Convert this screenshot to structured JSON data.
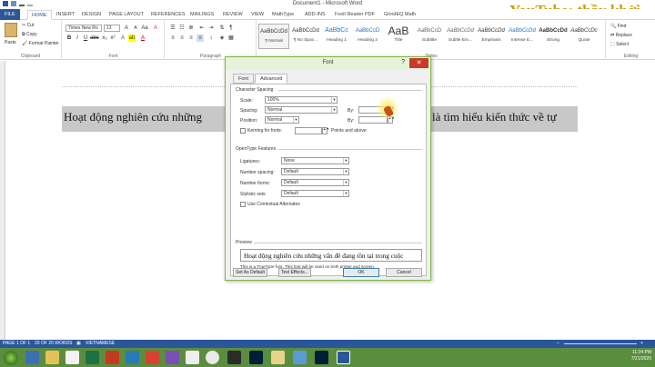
{
  "window": {
    "title": "Document1 - Microsoft Word"
  },
  "watermark": "YouTube: thầy khởi",
  "tabs": [
    "FILE",
    "HOME",
    "INSERT",
    "DESIGN",
    "PAGE LAYOUT",
    "REFERENCES",
    "MAILINGS",
    "REVIEW",
    "VIEW",
    "MathType",
    "ADD-INS",
    "Foxit Reader PDF",
    "GrindEQ Math"
  ],
  "ribbon": {
    "clipboard": {
      "paste": "Paste",
      "cut": "Cut",
      "copy": "Copy",
      "format_painter": "Format Painter",
      "label": "Clipboard"
    },
    "font": {
      "name": "Times New Ro",
      "size": "13",
      "label": "Font"
    },
    "paragraph": {
      "label": "Paragraph"
    },
    "styles": {
      "label": "Styles",
      "items": [
        {
          "sample": "AaBbCcDd",
          "name": "¶ Normal"
        },
        {
          "sample": "AaBbCcDd",
          "name": "¶ No Spac..."
        },
        {
          "sample": "AaBbCc",
          "name": "Heading 1"
        },
        {
          "sample": "AaBbCcD",
          "name": "Heading 2"
        },
        {
          "sample": "AaB",
          "name": "Title"
        },
        {
          "sample": "AaBbCcD",
          "name": "Subtitle"
        },
        {
          "sample": "AaBbCcDd",
          "name": "Subtle Em..."
        },
        {
          "sample": "AaBbCcDd",
          "name": "Emphasis"
        },
        {
          "sample": "AaBbCcDd",
          "name": "Intense E..."
        },
        {
          "sample": "AaBbCcDd",
          "name": "Strong"
        },
        {
          "sample": "AaBbCcDc",
          "name": "Quote"
        }
      ]
    },
    "editing": {
      "find": "Find",
      "replace": "Replace",
      "select": "Select",
      "label": "Editing"
    }
  },
  "document": {
    "text_left": "Hoạt động nghiên cứu những",
    "text_right": "là tìm hiểu kiến thức về tự"
  },
  "dialog": {
    "title": "Font",
    "help": "?",
    "close": "✕",
    "tab_font": "Font",
    "tab_advanced": "Advanced",
    "character_spacing": {
      "header": "Character Spacing",
      "scale_label": "Scale:",
      "scale_value": "100%",
      "spacing_label": "Spacing:",
      "spacing_value": "Normal",
      "position_label": "Position:",
      "position_value": "Normal",
      "by_label": "By:",
      "by2_label": "By:",
      "kerning_label": "Kerning for fonts:",
      "points_label": "Points and above"
    },
    "opentype": {
      "header": "OpenType Features",
      "ligatures_label": "Ligatures:",
      "ligatures_value": "None",
      "number_spacing_label": "Number spacing:",
      "number_spacing_value": "Default",
      "number_forms_label": "Number forms:",
      "number_forms_value": "Default",
      "stylistic_label": "Stylistic sets:",
      "stylistic_value": "Default",
      "contextual_label": "Use Contextual Alternates"
    },
    "preview": {
      "header": "Preview",
      "text": "Hoạt động nghiên cứu những vấn đề đang tồn tại trong cuộc",
      "note": "This is a TrueType font. This font will be used on both printer and screen."
    },
    "buttons": {
      "set_default": "Set As Default",
      "text_effects": "Text Effects...",
      "ok": "OK",
      "cancel": "Cancel"
    }
  },
  "statusbar": {
    "page": "PAGE 1 OF 1",
    "words": "20 OF 20 WORDS",
    "language": "VIETNAMESE"
  },
  "taskbar": {
    "time": "11:34 PM",
    "date": "7/21/2020"
  }
}
